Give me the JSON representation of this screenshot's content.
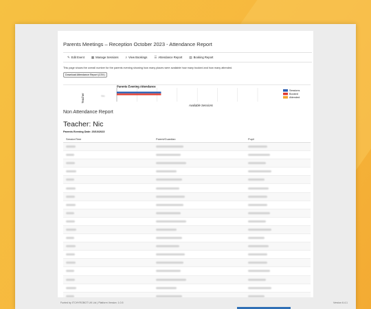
{
  "page": {
    "title": "Parents Meetings – Reception October 2023 - Attendance Report",
    "intro": "This page shows the overall number for the parents evening showing how many places were available how many booked and how many attended.",
    "download_label": "Download Attendance Report (CSV)",
    "non_attendance_title": "Non Attendance Report",
    "teacher_label": "Teacher: Nic",
    "parents_evening_date": "Parents Evening Date: 25/10/2023"
  },
  "toolbar": [
    {
      "label": "Edit Event",
      "icon": "pencil-icon"
    },
    {
      "label": "Manage Sessions",
      "icon": "calendar-icon"
    },
    {
      "label": "View Bookings",
      "icon": "search-icon"
    },
    {
      "label": "Attendance Report",
      "icon": "list-icon"
    },
    {
      "label": "Booking Report",
      "icon": "calendar-grid-icon"
    }
  ],
  "chart_data": {
    "type": "bar",
    "orientation": "horizontal",
    "title": "Parents Evening Attendance",
    "xlabel": "Available Sessions",
    "ylabel": "Teacher",
    "categories": [
      "Nic"
    ],
    "series": [
      {
        "name": "Sessions",
        "color": "#2a5db0",
        "values": [
          22
        ]
      },
      {
        "name": "Booked",
        "color": "#e03b2f",
        "values": [
          22
        ]
      },
      {
        "name": "Attended",
        "color": "#f3a42c",
        "values": [
          0
        ]
      }
    ],
    "legend": "right",
    "grid": true,
    "xlim": [
      0,
      70
    ]
  },
  "table": {
    "headers": [
      "SessionTime",
      "Parent/Guardian",
      "Pupil"
    ],
    "row_count": 21
  },
  "footer": {
    "left": "Fueled by ITCHYROBOT UK Ltd | Platform Version: 1.0.5",
    "right": "Version 6.4.1"
  },
  "colors": {
    "background": "#f7b73d",
    "window": "#ececec"
  }
}
